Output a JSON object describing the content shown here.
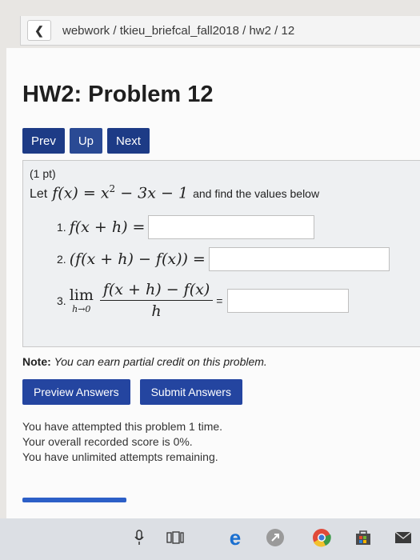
{
  "breadcrumb": "webwork / tkieu_briefcal_fall2018 / hw2 / 12",
  "title": "HW2: Problem 12",
  "nav": {
    "prev": "Prev",
    "up": "Up",
    "next": "Next"
  },
  "problem": {
    "points": "(1 pt)",
    "let": "Let",
    "function_text": "f(x) = x",
    "exponent": "2",
    "function_rest": " − 3x − 1",
    "statement_tail": "and find the values below",
    "parts": [
      {
        "number": "1.",
        "expr": "f(x + h) =",
        "value": ""
      },
      {
        "number": "2.",
        "expr": "(f(x + h) − f(x)) =",
        "value": ""
      },
      {
        "number": "3.",
        "lim": "lim",
        "lim_sub": "h→0",
        "numerator": "f(x + h) − f(x)",
        "denominator": "h",
        "eq": "=",
        "value": ""
      }
    ]
  },
  "note": {
    "label": "Note:",
    "text": "You can earn partial credit on this problem."
  },
  "actions": {
    "preview": "Preview Answers",
    "submit": "Submit Answers"
  },
  "status": [
    "You have attempted this problem 1 time.",
    "Your overall recorded score is 0%.",
    "You have unlimited attempts remaining."
  ],
  "taskbar": {
    "icons": [
      "microphone-icon",
      "task-view-icon",
      "edge-icon",
      "app-icon",
      "chrome-icon",
      "store-icon",
      "mail-icon"
    ]
  }
}
